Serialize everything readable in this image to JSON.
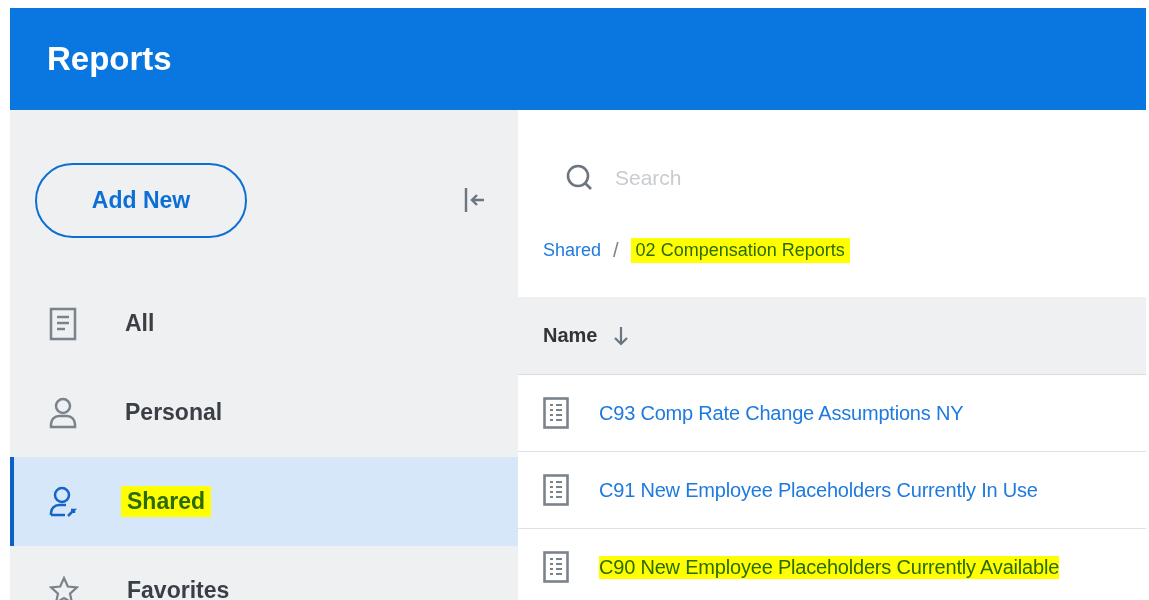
{
  "header": {
    "title": "Reports"
  },
  "sidebar": {
    "add_button": "Add New",
    "items": [
      {
        "label": "All",
        "kind": "document",
        "selected": false,
        "highlighted": false
      },
      {
        "label": "Personal",
        "kind": "person",
        "selected": false,
        "highlighted": false
      },
      {
        "label": "Shared",
        "kind": "shared",
        "selected": true,
        "highlighted": true
      },
      {
        "label": "Favorites",
        "kind": "star",
        "selected": false,
        "highlighted": false
      }
    ]
  },
  "search": {
    "placeholder": "Search"
  },
  "breadcrumb_separator": "/",
  "breadcrumb": [
    {
      "label": "Shared",
      "current": false,
      "highlighted": false
    },
    {
      "label": "02 Compensation Reports",
      "current": true,
      "highlighted": true
    }
  ],
  "table": {
    "columns": [
      {
        "label": "Name",
        "sorted": true
      }
    ],
    "rows": [
      {
        "name": "C93 Comp Rate Change Assumptions NY",
        "highlighted": false
      },
      {
        "name": "C91 New Employee Placeholders Currently In Use",
        "highlighted": false
      },
      {
        "name": "C90 New Employee Placeholders Currently Available",
        "highlighted": true
      }
    ]
  }
}
